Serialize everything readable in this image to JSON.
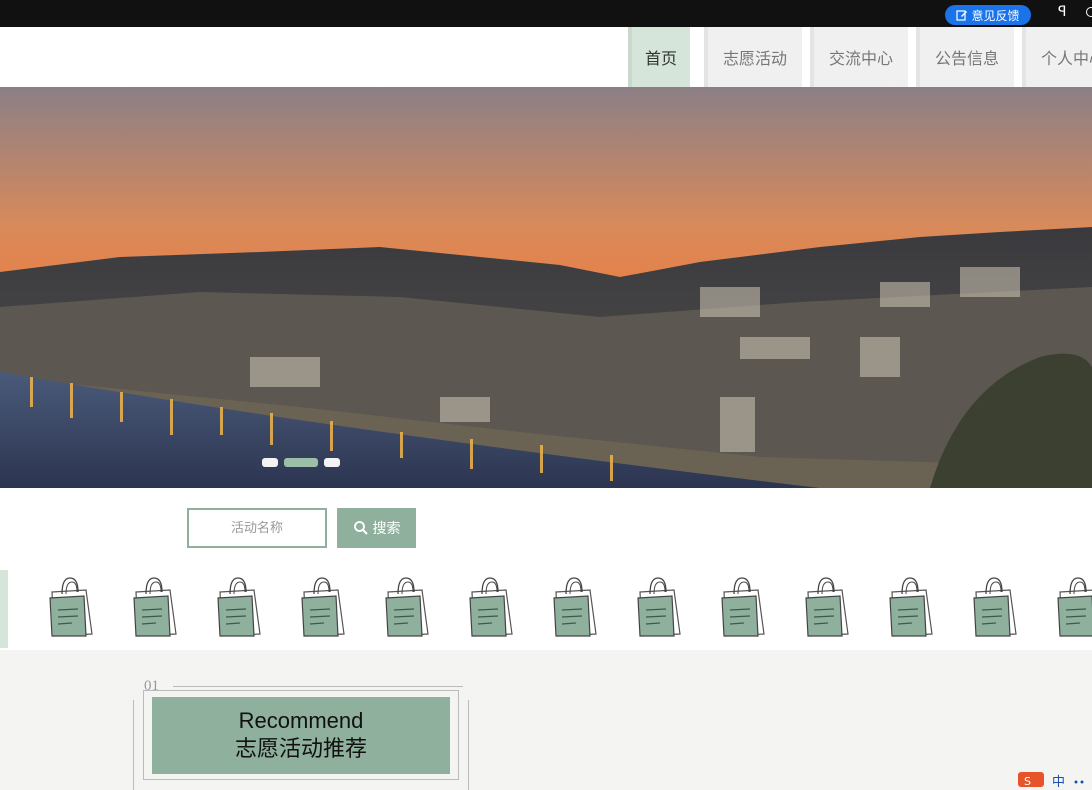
{
  "system_bar": {
    "feedback_label": "意见反馈",
    "pin_glyph": "ꟼ"
  },
  "nav": {
    "items": [
      {
        "label": "首页",
        "active": true
      },
      {
        "label": "志愿活动"
      },
      {
        "label": "交流中心"
      },
      {
        "label": "公告信息"
      },
      {
        "label": "个人中心"
      }
    ]
  },
  "banner": {
    "slides": 3,
    "active_slide": 2
  },
  "search": {
    "placeholder": "活动名称",
    "button_label": "搜索",
    "icon": "search-icon"
  },
  "icon_strip": {
    "icon": "shopping-bag-icon",
    "count": 13
  },
  "recommend": {
    "number": "01",
    "title_en": "Recommend",
    "title_cn": "志愿活动推荐"
  },
  "colors": {
    "accent": "#8fb09d",
    "accent_light": "#d6e5da",
    "topbar": "#111111",
    "feedback": "#1a73e8"
  }
}
